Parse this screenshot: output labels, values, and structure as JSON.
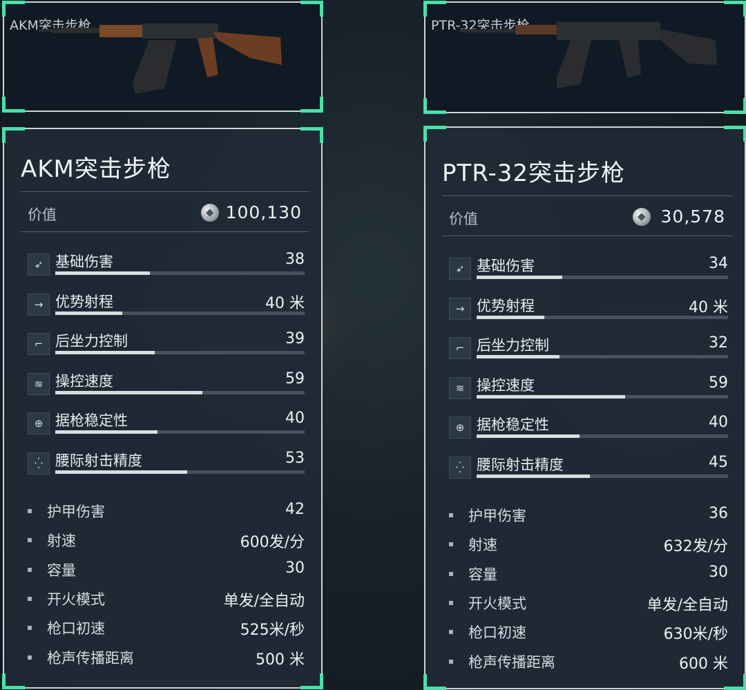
{
  "left": {
    "image_title": "AKM突击步枪",
    "name": "AKM突击步枪",
    "value_label": "价值",
    "value": "100,130",
    "stats": [
      {
        "icon": "bullet-impact-icon",
        "glyph": "➶",
        "label": "基础伤害",
        "value": "38",
        "level": 0.38
      },
      {
        "icon": "range-arrow-icon",
        "glyph": "→",
        "label": "优势射程",
        "value": "40 米",
        "level": 0.27
      },
      {
        "icon": "pistol-icon",
        "glyph": "⌐",
        "label": "后坐力控制",
        "value": "39",
        "level": 0.4
      },
      {
        "icon": "hand-icon",
        "glyph": "≋",
        "label": "操控速度",
        "value": "59",
        "level": 0.59
      },
      {
        "icon": "crosshair-icon",
        "glyph": "⊕",
        "label": "据枪稳定性",
        "value": "40",
        "level": 0.41
      },
      {
        "icon": "hipfire-icon",
        "glyph": "⁛",
        "label": "腰际射击精度",
        "value": "53",
        "level": 0.53
      }
    ],
    "attributes": [
      {
        "label": "护甲伤害",
        "value": "42"
      },
      {
        "label": "射速",
        "value": "600发/分"
      },
      {
        "label": "容量",
        "value": "30"
      },
      {
        "label": "开火模式",
        "value": "单发/全自动"
      },
      {
        "label": "枪口初速",
        "value": "525米/秒"
      },
      {
        "label": "枪声传播距离",
        "value": "500 米"
      }
    ]
  },
  "right": {
    "image_title": "PTR-32突击步枪",
    "name": "PTR-32突击步枪",
    "value_label": "价值",
    "value": "30,578",
    "stats": [
      {
        "icon": "bullet-impact-icon",
        "glyph": "➶",
        "label": "基础伤害",
        "value": "34",
        "level": 0.34
      },
      {
        "icon": "range-arrow-icon",
        "glyph": "→",
        "label": "优势射程",
        "value": "40 米",
        "level": 0.27
      },
      {
        "icon": "pistol-icon",
        "glyph": "⌐",
        "label": "后坐力控制",
        "value": "32",
        "level": 0.33
      },
      {
        "icon": "hand-icon",
        "glyph": "≋",
        "label": "操控速度",
        "value": "59",
        "level": 0.59
      },
      {
        "icon": "crosshair-icon",
        "glyph": "⊕",
        "label": "据枪稳定性",
        "value": "40",
        "level": 0.41
      },
      {
        "icon": "hipfire-icon",
        "glyph": "⁛",
        "label": "腰际射击精度",
        "value": "45",
        "level": 0.45
      }
    ],
    "attributes": [
      {
        "label": "护甲伤害",
        "value": "36"
      },
      {
        "label": "射速",
        "value": "632发/分"
      },
      {
        "label": "容量",
        "value": "30"
      },
      {
        "label": "开火模式",
        "value": "单发/全自动"
      },
      {
        "label": "枪口初速",
        "value": "630米/秒"
      },
      {
        "label": "枪声传播距离",
        "value": "600 米"
      }
    ]
  }
}
